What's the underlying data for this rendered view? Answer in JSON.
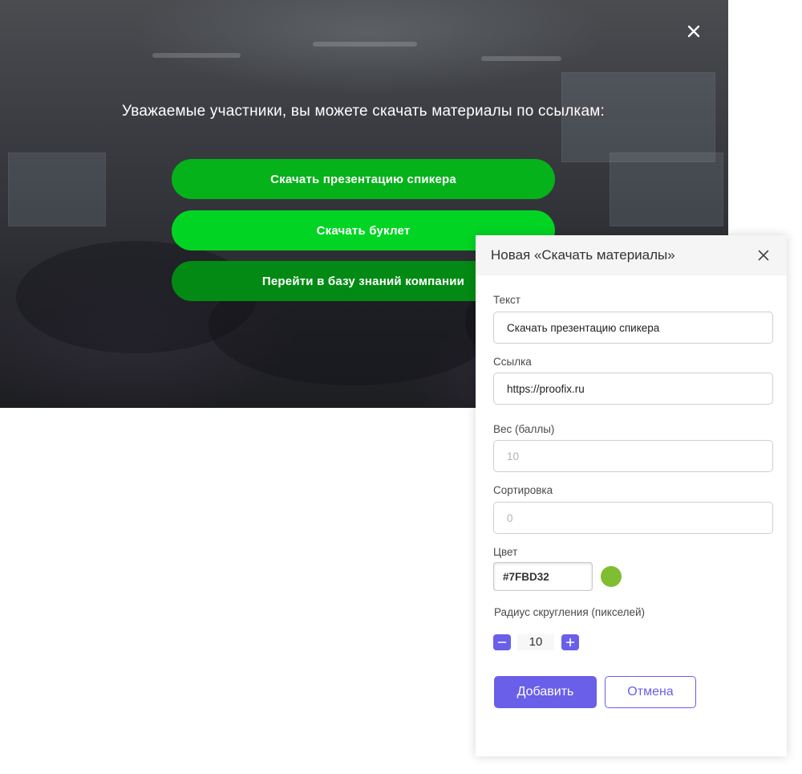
{
  "overlay": {
    "close_icon": "close-icon",
    "headline": "Уважаемые участники, вы можете скачать материалы по ссылкам:",
    "links": [
      {
        "label": "Скачать презентацию спикера",
        "color": "#05b21a"
      },
      {
        "label": "Скачать буклет",
        "color": "#02d424"
      },
      {
        "label": "Перейти в базу знаний компании",
        "color": "#038a14"
      }
    ]
  },
  "dialog": {
    "title": "Новая «Скачать материалы»",
    "close_icon": "close-icon",
    "fields": {
      "text": {
        "label": "Текст",
        "value": "Скачать презентацию спикера"
      },
      "link": {
        "label": "Ссылка",
        "value": "https://proofix.ru"
      },
      "weight": {
        "label": "Вес (баллы)",
        "placeholder": "10"
      },
      "sort": {
        "label": "Сортировка",
        "placeholder": "0"
      },
      "color": {
        "label": "Цвет",
        "value": "#7FBD32",
        "swatch": "#7fbd32"
      },
      "radius": {
        "label": "Радиус скругления (пикселей)",
        "value": "10",
        "decrement_icon": "minus-icon",
        "increment_icon": "plus-icon"
      }
    },
    "buttons": {
      "submit": "Добавить",
      "cancel": "Отмена"
    },
    "accent_color": "#6a5fe8"
  }
}
